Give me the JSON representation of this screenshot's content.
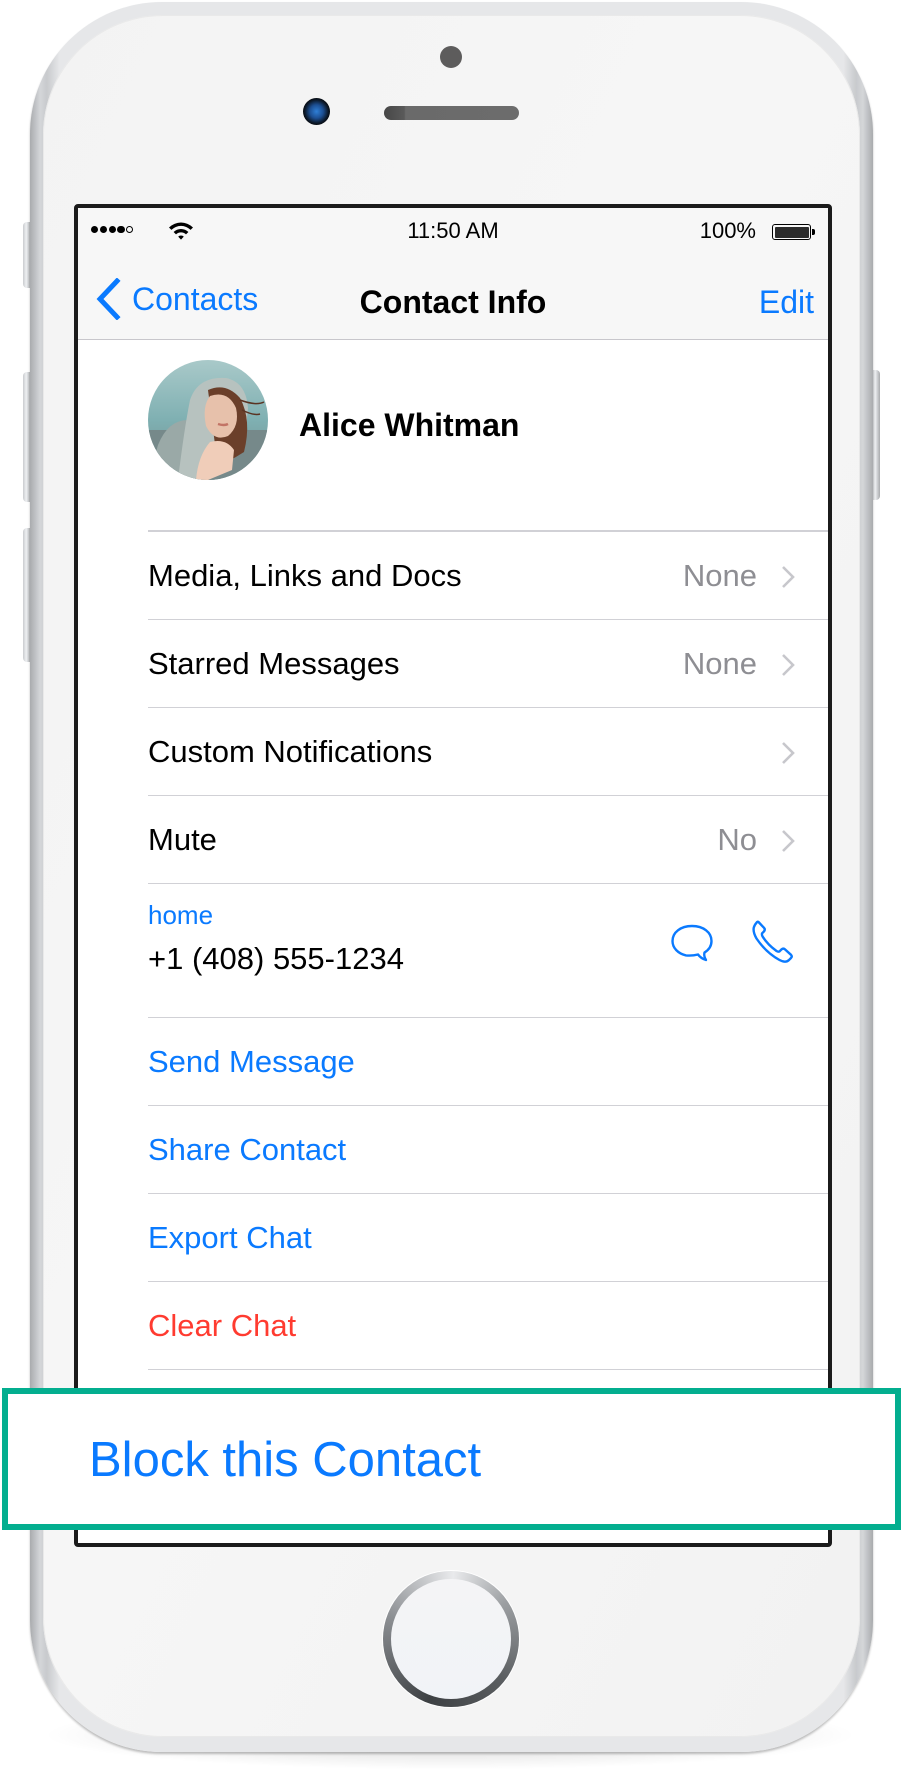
{
  "status_bar": {
    "signal_bars_filled": 4,
    "signal_bars_total": 5,
    "wifi_icon": "wifi-icon",
    "time": "11:50 AM",
    "battery_percent": "100%",
    "battery_level": 1.0
  },
  "nav": {
    "back_label": "Contacts",
    "title": "Contact Info",
    "edit_label": "Edit"
  },
  "contact": {
    "name": "Alice Whitman",
    "avatar": "profile-photo"
  },
  "settings_rows": [
    {
      "label": "Media, Links and Docs",
      "value": "None"
    },
    {
      "label": "Starred Messages",
      "value": "None"
    },
    {
      "label": "Custom Notifications",
      "value": ""
    },
    {
      "label": "Mute",
      "value": "No"
    }
  ],
  "phone": {
    "kind": "home",
    "number": "+1 (408) 555-1234",
    "message_icon": "message-bubble-icon",
    "call_icon": "phone-call-icon"
  },
  "actions": [
    {
      "label": "Send Message",
      "style": "action"
    },
    {
      "label": "Share Contact",
      "style": "action"
    },
    {
      "label": "Export Chat",
      "style": "action"
    },
    {
      "label": "Clear Chat",
      "style": "danger"
    }
  ],
  "highlight": {
    "label": "Block this Contact",
    "border_color": "#03ae8f"
  },
  "colors": {
    "ios_blue": "#0a7aff",
    "destructive_red": "#ff3b30",
    "secondary_gray": "#8e8e93",
    "highlight_teal": "#03ae8f"
  }
}
